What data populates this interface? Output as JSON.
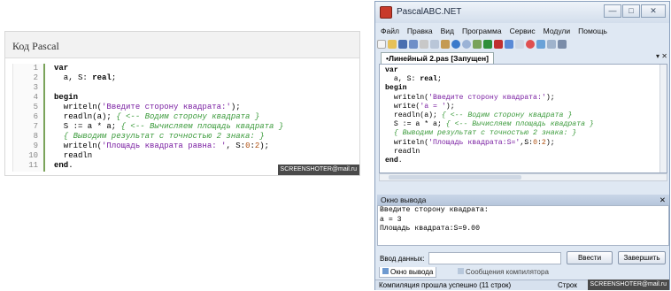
{
  "snippet": {
    "title": "Код Pascal",
    "watermark": "SCREENSHOTER@mail.ru",
    "line_numbers": [
      "1",
      "2",
      "3",
      "4",
      "5",
      "6",
      "7",
      "8",
      "9",
      "10",
      "11"
    ],
    "lines": [
      [
        {
          "t": "var",
          "c": "kw"
        }
      ],
      [
        {
          "t": "  a, S: ",
          "c": ""
        },
        {
          "t": "real",
          "c": "kw"
        },
        {
          "t": ";",
          "c": ""
        }
      ],
      [
        {
          "t": "",
          "c": ""
        }
      ],
      [
        {
          "t": "begin",
          "c": "kw"
        }
      ],
      [
        {
          "t": "  writeln(",
          "c": ""
        },
        {
          "t": "'Введите сторону квадрата:'",
          "c": "str"
        },
        {
          "t": ");",
          "c": ""
        }
      ],
      [
        {
          "t": "  readln(a); ",
          "c": ""
        },
        {
          "t": "{ <-- Водим сторону квадрата }",
          "c": "cm"
        }
      ],
      [
        {
          "t": "  S := a * a; ",
          "c": ""
        },
        {
          "t": "{ <-- Вычисляем площадь квадрата }",
          "c": "cm"
        }
      ],
      [
        {
          "t": "  { Выводим результат с точностью 2 знака: }",
          "c": "cm"
        }
      ],
      [
        {
          "t": "  writeln(",
          "c": ""
        },
        {
          "t": "'Площадь квадрата равна: '",
          "c": "str"
        },
        {
          "t": ", S:",
          "c": ""
        },
        {
          "t": "0",
          "c": "num"
        },
        {
          "t": ":",
          "c": ""
        },
        {
          "t": "2",
          "c": "num"
        },
        {
          "t": ");",
          "c": ""
        }
      ],
      [
        {
          "t": "  readln",
          "c": ""
        }
      ],
      [
        {
          "t": "end",
          "c": "kw"
        },
        {
          "t": ".",
          "c": ""
        }
      ]
    ]
  },
  "window": {
    "title": "PascalABC.NET",
    "menu": [
      "Файл",
      "Правка",
      "Вид",
      "Программа",
      "Сервис",
      "Модули",
      "Помощь"
    ],
    "tab_label": "•Линейный 2.pas [Запущен]",
    "tab_controls": "▾ ✕",
    "editor_lines": [
      [
        {
          "t": "var",
          "c": "kw"
        }
      ],
      [
        {
          "t": "  a, S: ",
          "c": ""
        },
        {
          "t": "real",
          "c": "kw"
        },
        {
          "t": ";",
          "c": ""
        }
      ],
      [
        {
          "t": "begin",
          "c": "kw"
        }
      ],
      [
        {
          "t": "  writeln(",
          "c": ""
        },
        {
          "t": "'Введите сторону квадрата:'",
          "c": "str"
        },
        {
          "t": ");",
          "c": ""
        }
      ],
      [
        {
          "t": "  write(",
          "c": ""
        },
        {
          "t": "'a = '",
          "c": "str"
        },
        {
          "t": ");",
          "c": ""
        }
      ],
      [
        {
          "t": "  readln(a); ",
          "c": ""
        },
        {
          "t": "{ <-- Водим сторону квадрата }",
          "c": "cm"
        }
      ],
      [
        {
          "t": "  S := a * a; ",
          "c": ""
        },
        {
          "t": "{ <-- Вычисляем площадь квадрата }",
          "c": "cm"
        }
      ],
      [
        {
          "t": "  { Выводим результат с точностью 2 знака: }",
          "c": "cm"
        }
      ],
      [
        {
          "t": "  writeln(",
          "c": ""
        },
        {
          "t": "'Площадь квадрата:S='",
          "c": "str"
        },
        {
          "t": ",S:",
          "c": ""
        },
        {
          "t": "0",
          "c": "num"
        },
        {
          "t": ":",
          "c": ""
        },
        {
          "t": "2",
          "c": "num"
        },
        {
          "t": ");",
          "c": ""
        }
      ],
      [
        {
          "t": "  readln",
          "c": ""
        }
      ],
      [
        {
          "t": "end",
          "c": "kw"
        },
        {
          "t": ".",
          "c": ""
        }
      ]
    ],
    "output_title": "Окно вывода",
    "output_pin": "✕",
    "output_lines": [
      "Введите сторону квадрата:",
      "a = 3",
      "Площадь квадрата:S=9.00"
    ],
    "input_label": "Ввод данных:",
    "input_value": "",
    "enter_button": "Ввести",
    "finish_button": "Завершить",
    "bottom_tab_output": "Окно вывода",
    "bottom_tab_messages": "Сообщения компилятора",
    "status_text": "Компиляция прошла успешно (11 строк)",
    "status_right": "Строк",
    "watermark": "SCREENSHOTER@mail.ru"
  },
  "colors": {
    "accent": "#3c9b3c",
    "string": "#7a1fa2",
    "number": "#b05010"
  }
}
